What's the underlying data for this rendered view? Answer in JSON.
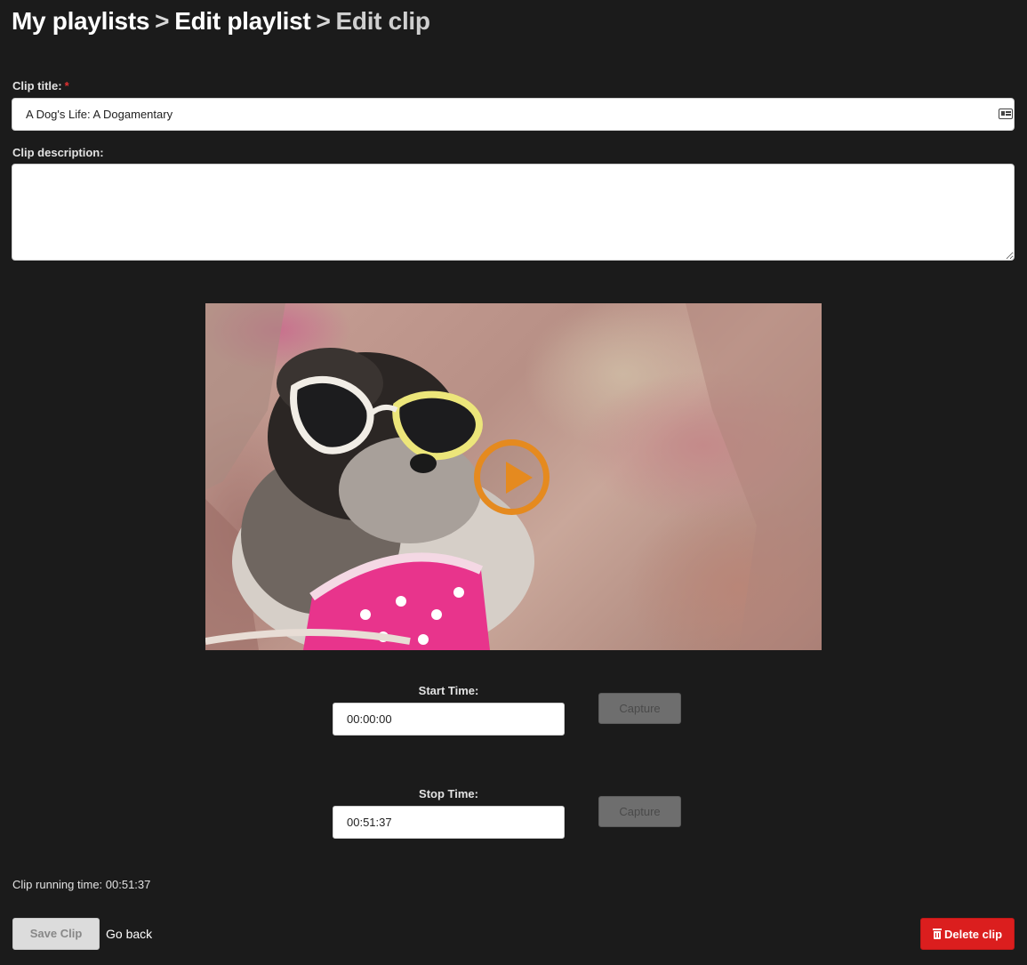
{
  "breadcrumb": {
    "items": [
      "My playlists",
      "Edit playlist",
      "Edit clip"
    ],
    "separator": ">"
  },
  "form": {
    "title_label": "Clip title:",
    "required_mark": "*",
    "title_value": "A Dog's Life: A Dogamentary",
    "description_label": "Clip description:",
    "description_value": ""
  },
  "video": {
    "play_icon": "play-icon"
  },
  "times": {
    "start_label": "Start Time:",
    "start_value": "00:00:00",
    "stop_label": "Stop Time:",
    "stop_value": "00:51:37",
    "capture_label": "Capture"
  },
  "running_time": "Clip running time: 00:51:37",
  "actions": {
    "save_label": "Save Clip",
    "go_back_label": "Go back",
    "delete_label": "Delete clip"
  },
  "colors": {
    "background": "#1b1b1b",
    "accent_play": "#e58a1f",
    "delete": "#db1e1e"
  }
}
